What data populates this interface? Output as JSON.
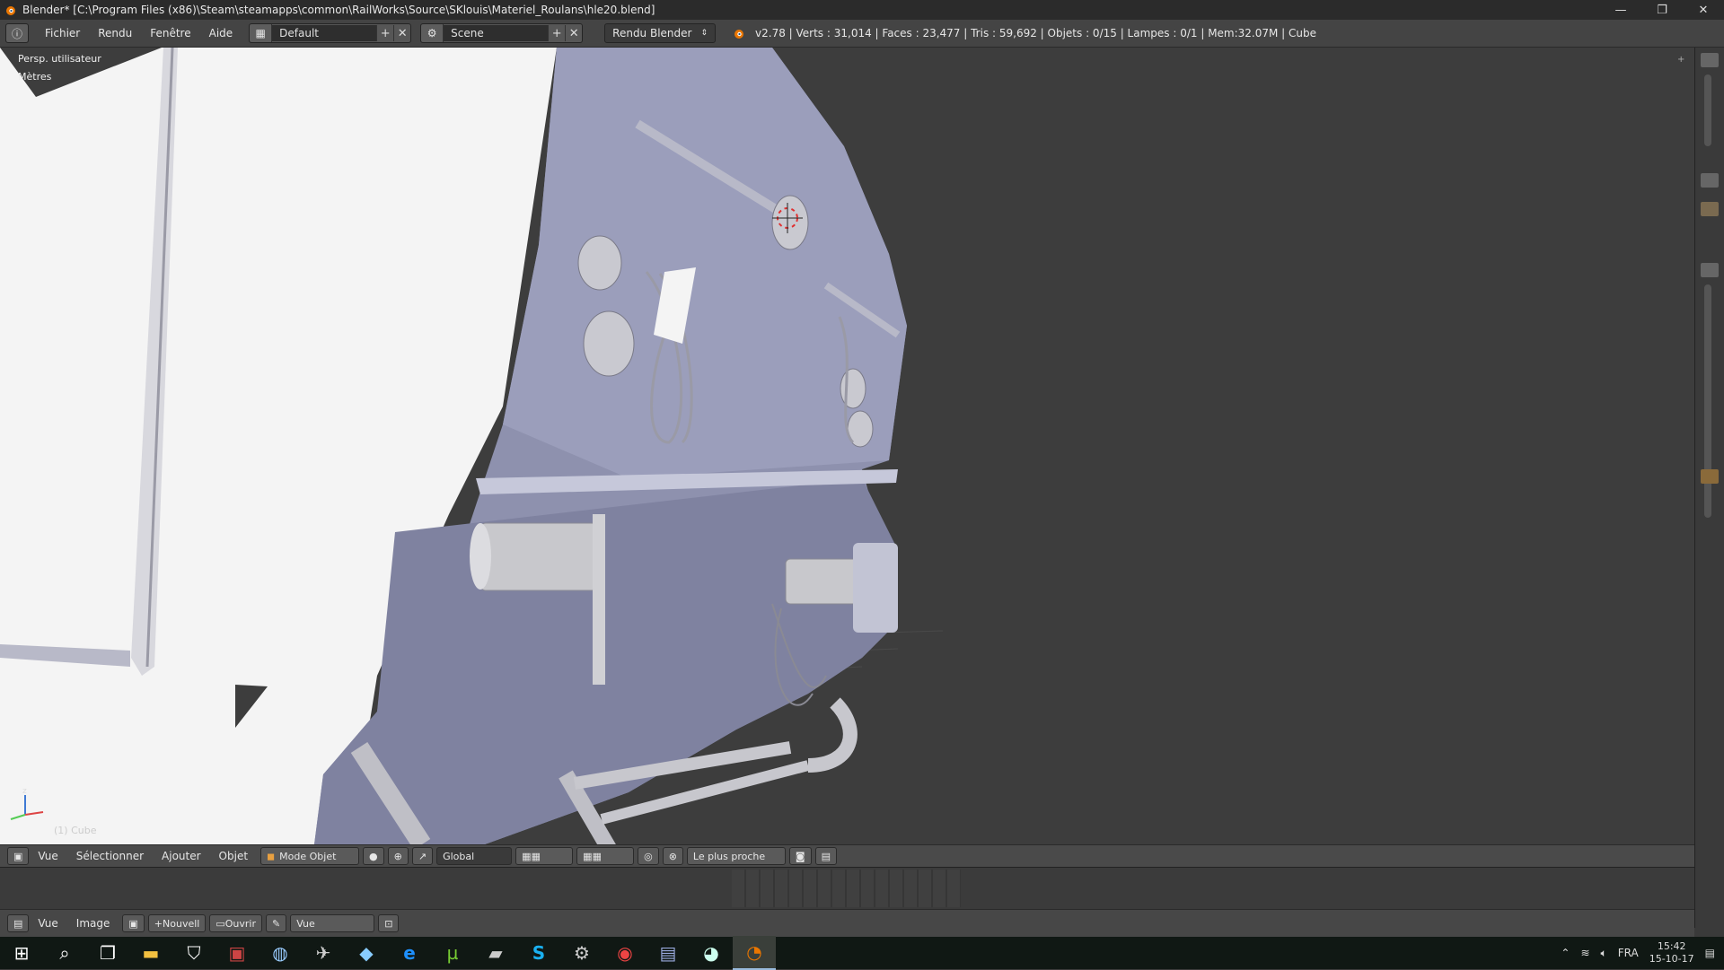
{
  "window": {
    "title": "Blender* [C:\\Program Files (x86)\\Steam\\steamapps\\common\\RailWorks\\Source\\SKlouis\\Materiel_Roulans\\hle20.blend]",
    "controls": {
      "minimize": "—",
      "restore": "❐",
      "close": "✕"
    }
  },
  "menubar": {
    "editor_icon": "info-icon",
    "items": [
      "Fichier",
      "Rendu",
      "Fenêtre",
      "Aide"
    ],
    "layout_name": "Default",
    "scene_name": "Scene",
    "render_engine": "Rendu Blender",
    "stats": "v2.78 | Verts : 31,014 | Faces : 23,477 | Tris : 59,692 | Objets : 0/15 | Lampes : 0/1 | Mem:32.07M | Cube"
  },
  "viewport": {
    "view_label": "Persp. utilisateur",
    "units_label": "Mètres",
    "object_label": "(1) Cube",
    "colors": {
      "background": "#3d3d3d",
      "model": "#8e91ae",
      "model_light": "#a6a9c6",
      "chrome": "#c8c8cc",
      "white": "#f2f2f2"
    }
  },
  "view3d_header": {
    "menus": [
      "Vue",
      "Sélectionner",
      "Ajouter",
      "Objet"
    ],
    "mode": "Mode Objet",
    "orientation": "Global",
    "snap_target": "Le plus proche"
  },
  "image_header": {
    "menus": [
      "Vue",
      "Image"
    ],
    "new_label": "Nouvell",
    "open_label": "Ouvrir",
    "view_mode": "Vue"
  },
  "taskbar": {
    "apps": [
      "start-icon",
      "search-icon",
      "task-view-icon",
      "file-explorer-icon",
      "store-icon",
      "app-icon-1",
      "app-icon-2",
      "app-icon-3",
      "app-icon-4",
      "edge-icon",
      "utorrent-icon",
      "app-icon-5",
      "skype-icon",
      "settings-icon",
      "chrome-icon",
      "app-icon-6",
      "steam-icon",
      "blender-icon"
    ],
    "language": "FRA",
    "time": "15:42",
    "date": "15-10-17"
  }
}
